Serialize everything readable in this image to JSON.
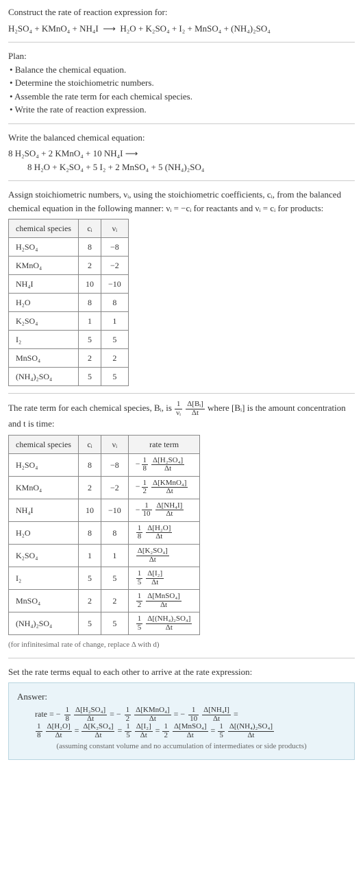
{
  "header": {
    "title": "Construct the rate of reaction expression for:",
    "equation_lhs": "H₂SO₄ + KMnO₄ + NH₄I",
    "equation_rhs": "H₂O + K₂SO₄ + I₂ + MnSO₄ + (NH₄)₂SO₄"
  },
  "plan": {
    "title": "Plan:",
    "items": [
      "Balance the chemical equation.",
      "Determine the stoichiometric numbers.",
      "Assemble the rate term for each chemical species.",
      "Write the rate of reaction expression."
    ]
  },
  "balanced": {
    "title": "Write the balanced chemical equation:",
    "lhs": "8 H₂SO₄ + 2 KMnO₄ + 10 NH₄I",
    "rhs": "8 H₂O + K₂SO₄ + 5 I₂ + 2 MnSO₄ + 5 (NH₄)₂SO₄"
  },
  "stoich": {
    "intro_a": "Assign stoichiometric numbers, νᵢ, using the stoichiometric coefficients, cᵢ, from the balanced chemical equation in the following manner: νᵢ = −cᵢ for reactants and νᵢ = cᵢ for products:",
    "headers": [
      "chemical species",
      "cᵢ",
      "νᵢ"
    ],
    "rows": [
      {
        "species": "H₂SO₄",
        "c": "8",
        "v": "−8"
      },
      {
        "species": "KMnO₄",
        "c": "2",
        "v": "−2"
      },
      {
        "species": "NH₄I",
        "c": "10",
        "v": "−10"
      },
      {
        "species": "H₂O",
        "c": "8",
        "v": "8"
      },
      {
        "species": "K₂SO₄",
        "c": "1",
        "v": "1"
      },
      {
        "species": "I₂",
        "c": "5",
        "v": "5"
      },
      {
        "species": "MnSO₄",
        "c": "2",
        "v": "2"
      },
      {
        "species": "(NH₄)₂SO₄",
        "c": "5",
        "v": "5"
      }
    ]
  },
  "rateterm": {
    "intro_a": "The rate term for each chemical species, Bᵢ, is ",
    "intro_b": " where [Bᵢ] is the amount concentration and t is time:",
    "headers": [
      "chemical species",
      "cᵢ",
      "νᵢ",
      "rate term"
    ],
    "rows": [
      {
        "species": "H₂SO₄",
        "c": "8",
        "v": "−8",
        "neg": "−",
        "fnum": "1",
        "fden": "8",
        "dnum": "Δ[H₂SO₄]",
        "dden": "Δt"
      },
      {
        "species": "KMnO₄",
        "c": "2",
        "v": "−2",
        "neg": "−",
        "fnum": "1",
        "fden": "2",
        "dnum": "Δ[KMnO₄]",
        "dden": "Δt"
      },
      {
        "species": "NH₄I",
        "c": "10",
        "v": "−10",
        "neg": "−",
        "fnum": "1",
        "fden": "10",
        "dnum": "Δ[NH₄I]",
        "dden": "Δt"
      },
      {
        "species": "H₂O",
        "c": "8",
        "v": "8",
        "neg": "",
        "fnum": "1",
        "fden": "8",
        "dnum": "Δ[H₂O]",
        "dden": "Δt"
      },
      {
        "species": "K₂SO₄",
        "c": "1",
        "v": "1",
        "neg": "",
        "fnum": "",
        "fden": "",
        "dnum": "Δ[K₂SO₄]",
        "dden": "Δt"
      },
      {
        "species": "I₂",
        "c": "5",
        "v": "5",
        "neg": "",
        "fnum": "1",
        "fden": "5",
        "dnum": "Δ[I₂]",
        "dden": "Δt"
      },
      {
        "species": "MnSO₄",
        "c": "2",
        "v": "2",
        "neg": "",
        "fnum": "1",
        "fden": "2",
        "dnum": "Δ[MnSO₄]",
        "dden": "Δt"
      },
      {
        "species": "(NH₄)₂SO₄",
        "c": "5",
        "v": "5",
        "neg": "",
        "fnum": "1",
        "fden": "5",
        "dnum": "Δ[(NH₄)₂SO₄]",
        "dden": "Δt"
      }
    ],
    "footnote": "(for infinitesimal rate of change, replace Δ with d)"
  },
  "final": {
    "intro": "Set the rate terms equal to each other to arrive at the rate expression:",
    "answer_label": "Answer:",
    "rate_prefix": "rate = ",
    "terms": [
      {
        "neg": "−",
        "fnum": "1",
        "fden": "8",
        "dnum": "Δ[H₂SO₄]",
        "dden": "Δt"
      },
      {
        "neg": "−",
        "fnum": "1",
        "fden": "2",
        "dnum": "Δ[KMnO₄]",
        "dden": "Δt"
      },
      {
        "neg": "−",
        "fnum": "1",
        "fden": "10",
        "dnum": "Δ[NH₄I]",
        "dden": "Δt"
      },
      {
        "neg": "",
        "fnum": "1",
        "fden": "8",
        "dnum": "Δ[H₂O]",
        "dden": "Δt"
      },
      {
        "neg": "",
        "fnum": "",
        "fden": "",
        "dnum": "Δ[K₂SO₄]",
        "dden": "Δt"
      },
      {
        "neg": "",
        "fnum": "1",
        "fden": "5",
        "dnum": "Δ[I₂]",
        "dden": "Δt"
      },
      {
        "neg": "",
        "fnum": "1",
        "fden": "2",
        "dnum": "Δ[MnSO₄]",
        "dden": "Δt"
      },
      {
        "neg": "",
        "fnum": "1",
        "fden": "5",
        "dnum": "Δ[(NH₄)₂SO₄]",
        "dden": "Δt"
      }
    ],
    "assumption": "(assuming constant volume and no accumulation of intermediates or side products)"
  }
}
